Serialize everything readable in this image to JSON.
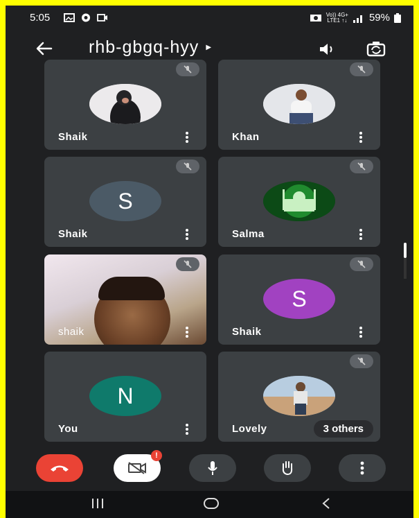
{
  "status_bar": {
    "time": "5:05",
    "network_label_top": "Vo)) 4G+",
    "network_label_bottom": "LTE1 ↑↓",
    "battery": "59%",
    "icons": [
      "gallery-icon",
      "shield-icon",
      "video-icon",
      "alarm-icon",
      "signal-icon",
      "battery-icon"
    ]
  },
  "header": {
    "meeting_code": "rhb-gbgq-hyy",
    "icons": [
      "back-arrow-icon",
      "caret-right-icon",
      "speaker-icon",
      "switch-camera-icon"
    ]
  },
  "participants": [
    {
      "name": "Shaik",
      "avatar_type": "photo",
      "muted": true
    },
    {
      "name": "Khan",
      "avatar_type": "photo",
      "muted": true
    },
    {
      "name": "Shaik",
      "avatar_type": "initial",
      "initial": "S",
      "avatar_color": "#4b5a66",
      "muted": true
    },
    {
      "name": "Salma",
      "avatar_type": "photo",
      "muted": true
    },
    {
      "name": "shaik",
      "avatar_type": "video",
      "muted": true
    },
    {
      "name": "Shaik",
      "avatar_type": "initial",
      "initial": "S",
      "avatar_color": "#a142c1",
      "muted": true
    },
    {
      "name": "You",
      "avatar_type": "initial",
      "initial": "N",
      "avatar_color": "#0f7a6b",
      "muted": false
    },
    {
      "name": "Lovely",
      "avatar_type": "photo",
      "muted": true,
      "others_label": "3 others"
    }
  ],
  "controls": {
    "buttons": [
      "end-call",
      "camera-off",
      "microphone",
      "raise-hand",
      "more-options"
    ],
    "camera_badge": "!",
    "end_call_color": "#ea4335"
  },
  "navbar": {
    "icons": [
      "recents-icon",
      "home-icon",
      "back-icon"
    ]
  }
}
